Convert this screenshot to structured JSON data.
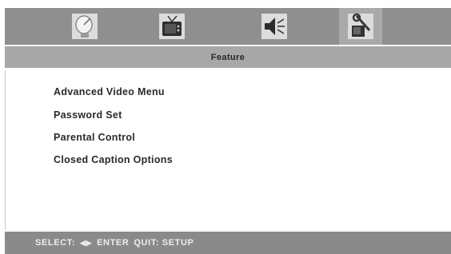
{
  "header": {
    "tabs": [
      {
        "icon": "satellite-dish-icon",
        "active": false
      },
      {
        "icon": "tv-icon",
        "active": false
      },
      {
        "icon": "speaker-icon",
        "active": false
      },
      {
        "icon": "tools-icon",
        "active": true
      }
    ]
  },
  "title": "Feature",
  "menu": {
    "items": [
      {
        "label": "Advanced Video Menu"
      },
      {
        "label": "Password Set"
      },
      {
        "label": "Parental Control"
      },
      {
        "label": "Closed Caption Options"
      }
    ]
  },
  "footer": {
    "select_label": "SELECT:",
    "arrows_icon": "left-right-arrows-icon",
    "enter_label": "ENTER",
    "quit_label": "QUIT: SETUP"
  },
  "colors": {
    "iconbar": "#8f8f8f",
    "titlebar": "#a7a7a7",
    "statusbar": "#8a8a8a",
    "menu_text": "#2a2a2a"
  }
}
